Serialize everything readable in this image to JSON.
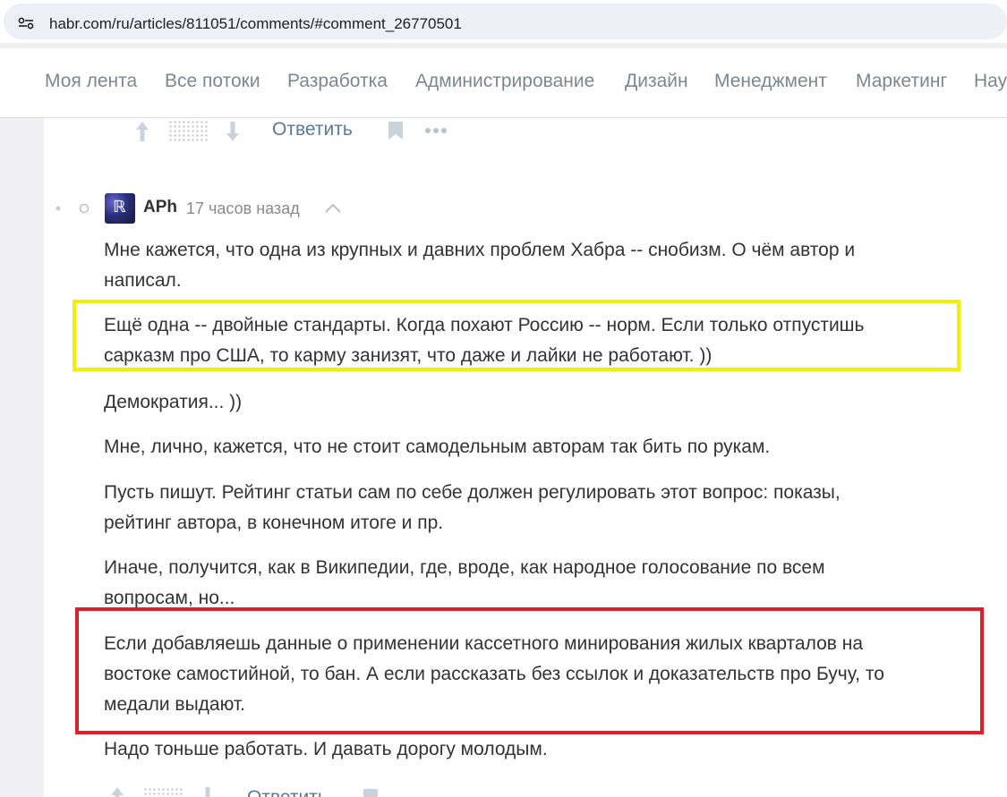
{
  "browser": {
    "url": "habr.com/ru/articles/811051/comments/#comment_26770501"
  },
  "nav": {
    "items": [
      "Моя лента",
      "Все потоки",
      "Разработка",
      "Администрирование",
      "Дизайн",
      "Менеджмент",
      "Маркетинг",
      "Нау"
    ]
  },
  "prev_comment_actions": {
    "reply_label": "Ответить"
  },
  "comment": {
    "author": "APh",
    "time": "17 часов назад",
    "paragraphs": [
      "Мне кажется, что одна из крупных и давних проблем Хабра -- снобизм. О чём автор и\nнаписал.",
      "Ещё одна -- двойные стандарты. Когда похают Россию -- норм. Если только отпустишь\nсарказм про США, то карму занизят, что даже и лайки не работают. ))",
      "Демократия... ))",
      "Мне, лично, кажется, что не стоит самодельным авторам так бить по рукам.",
      "Пусть пишут. Рейтинг статьи сам по себе должен регулировать этот вопрос: показы,\nрейтинг автора, в конечном итоге и пр.",
      "Иначе, получится, как в Википедии, где, вроде, как народное голосование по всем\nвопросам, но...",
      "Если добавляешь данные о применении кассетного минирования жилых кварталов на\nвостоке самостийной, то бан. А если рассказать без ссылок и доказательств про Бучу, то\nмедали выдают.",
      "Надо тоньше работать. И давать дорогу молодым."
    ],
    "reply_label": "Ответить"
  },
  "highlight_colors": {
    "yellow": "#f4ee00",
    "red": "#e01f2a"
  }
}
